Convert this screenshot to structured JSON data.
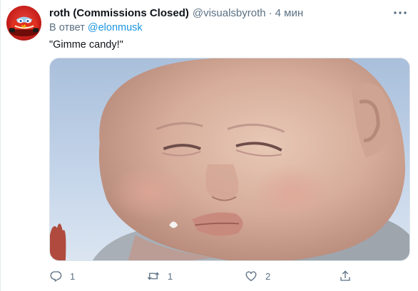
{
  "tweet": {
    "author": {
      "display_name": "roth (Commissions Closed)",
      "handle": "@visualsbyroth",
      "avatar_icon": "red-race-car-avatar"
    },
    "separator": "·",
    "time": "4 мин",
    "reply_prefix": "В ответ",
    "reply_to": "@elonmusk",
    "text": "\"Gimme candy!\"",
    "media": {
      "kind": "photo",
      "subject": "baby"
    },
    "actions": {
      "reply": {
        "icon": "reply-icon",
        "count": "1"
      },
      "retweet": {
        "icon": "retweet-icon",
        "count": "1"
      },
      "like": {
        "icon": "heart-icon",
        "count": "2"
      },
      "share": {
        "icon": "share-icon"
      }
    },
    "colors": {
      "link": "#1b95e0",
      "secondary_text": "#5b7083",
      "icon": "#5b7083",
      "primary_text": "#0f1419"
    }
  }
}
